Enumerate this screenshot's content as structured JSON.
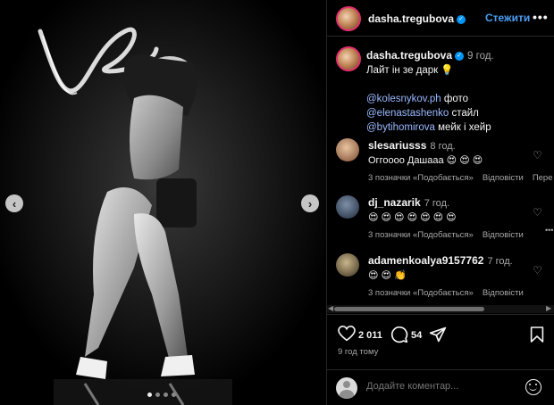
{
  "media": {
    "prev_arrow": "‹",
    "next_arrow": "›",
    "carousel_total": 4,
    "carousel_active_index": 1
  },
  "header": {
    "username": "dasha.tregubova",
    "verified_mark": "✓",
    "follow_label": "Стежити",
    "more_icon": "•••"
  },
  "caption": {
    "username": "dasha.tregubova",
    "time": "9 год.",
    "line1": "Лайт ін зе дарк 💡",
    "credits": [
      {
        "mention": "@kolesnykov.ph",
        "role": "фото"
      },
      {
        "mention": "@elenastashenko",
        "role": "стайл"
      },
      {
        "mention": "@bytihomirova",
        "role": "мейк і хейр"
      }
    ]
  },
  "comments": [
    {
      "username": "slesariusss",
      "time": "8 год.",
      "text": "Оггоооо Дашааа 😍 😍 😍",
      "likes": "3 позначки «Подобається»",
      "reply": "Відповісти",
      "translate": "Пере"
    },
    {
      "username": "dj_nazarik",
      "time": "7 год.",
      "text": "😍 😍 😍 😍 😍 😍 😍",
      "likes": "3 позначки «Подобається»",
      "reply": "Відповісти"
    },
    {
      "username": "adamenkoalya9157762",
      "time": "7 год.",
      "text": "😍 😍 👏",
      "likes": "3 позначки «Подобається»",
      "reply": "Відповісти"
    }
  ],
  "actions": {
    "likes_count": "2 011",
    "comments_count": "54",
    "post_time": "9 год тому"
  },
  "add_comment": {
    "placeholder": "Додайте коментар..."
  },
  "colors": {
    "accent": "#0095f6",
    "follow": "#4a9ef5",
    "mention": "#9ab8ff",
    "muted": "#a8a8a8"
  }
}
